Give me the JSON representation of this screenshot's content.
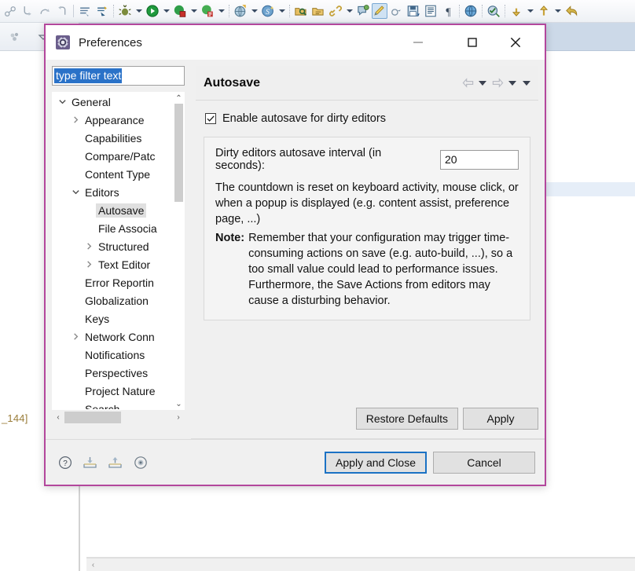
{
  "ide": {
    "toolbar_groups": [
      {
        "icons": [
          "debug-last-icon",
          "step-into-icon",
          "step-over-icon",
          "step-return-icon"
        ]
      },
      {
        "sep": "solid",
        "icons": [
          "run-menu-icon",
          "external-tools-icon"
        ]
      },
      {
        "sep": "dotted",
        "icons": [
          "debug-icon"
        ],
        "caret": true
      },
      {
        "icons": [
          "run-icon"
        ],
        "caret": true
      },
      {
        "icons": [
          "coverage-icon"
        ],
        "caret": true
      },
      {
        "icons": [
          "profile-icon"
        ],
        "caret": true
      },
      {
        "sep": "dotted",
        "icons": [
          "new-server-icon"
        ],
        "caret": true
      },
      {
        "icons": [
          "search-scm-icon"
        ],
        "caret": true
      },
      {
        "sep": "dotted",
        "icons": [
          "open-type-icon",
          "open-resource-icon",
          "link-icon"
        ],
        "caret": true
      },
      {
        "icons": [
          "annotation-icon",
          "pencil-highlight-icon",
          "quick-access-icon"
        ]
      },
      {
        "icons": [
          "save-all-icon",
          "block-selection-icon",
          "pilcrow-icon"
        ]
      },
      {
        "sep": "dotted",
        "icons": [
          "globe-icon"
        ]
      },
      {
        "sep": "dotted",
        "icons": [
          "validate-icon"
        ]
      },
      {
        "sep": "dotted",
        "icons": [
          "previous-annotation-icon"
        ],
        "caret": true
      },
      {
        "icons": [
          "next-annotation-icon"
        ],
        "caret": true
      },
      {
        "icons": [
          "back-nav-icon"
        ]
      }
    ],
    "strip2_icons": [
      "package-explorer-icon",
      "view-menu-icon"
    ],
    "left_pane_text": "_144]",
    "hscroll_left_arrow": "‹"
  },
  "dialog": {
    "title": "Preferences",
    "title_icon": "preferences-gear-icon",
    "window_buttons": {
      "minimize": "minimize-icon",
      "maximize": "maximize-icon",
      "close": "close-icon"
    },
    "filter": {
      "value": "type filter text",
      "placeholder": "type filter text"
    },
    "tree": [
      {
        "label": "General",
        "indent": 0,
        "twisty": "expanded",
        "selected": false
      },
      {
        "label": "Appearance",
        "indent": 1,
        "twisty": "collapsed",
        "selected": false
      },
      {
        "label": "Capabilities",
        "indent": 1,
        "twisty": "none",
        "selected": false
      },
      {
        "label": "Compare/Patc",
        "indent": 1,
        "twisty": "none",
        "selected": false
      },
      {
        "label": "Content Type",
        "indent": 1,
        "twisty": "none",
        "selected": false
      },
      {
        "label": "Editors",
        "indent": 1,
        "twisty": "expanded",
        "selected": false
      },
      {
        "label": "Autosave",
        "indent": 2,
        "twisty": "none",
        "selected": true
      },
      {
        "label": "File Associa",
        "indent": 2,
        "twisty": "none",
        "selected": false
      },
      {
        "label": "Structured",
        "indent": 2,
        "twisty": "collapsed",
        "selected": false
      },
      {
        "label": "Text Editor",
        "indent": 2,
        "twisty": "collapsed",
        "selected": false
      },
      {
        "label": "Error Reportin",
        "indent": 1,
        "twisty": "none",
        "selected": false
      },
      {
        "label": "Globalization",
        "indent": 1,
        "twisty": "none",
        "selected": false
      },
      {
        "label": "Keys",
        "indent": 1,
        "twisty": "none",
        "selected": false
      },
      {
        "label": "Network Conn",
        "indent": 1,
        "twisty": "collapsed",
        "selected": false
      },
      {
        "label": "Notifications",
        "indent": 1,
        "twisty": "none",
        "selected": false
      },
      {
        "label": "Perspectives",
        "indent": 1,
        "twisty": "none",
        "selected": false
      },
      {
        "label": "Project Nature",
        "indent": 1,
        "twisty": "none",
        "selected": false
      },
      {
        "label": "Search",
        "indent": 1,
        "twisty": "none",
        "selected": false
      }
    ],
    "tree_scroll": {
      "up_arrow": "⌃",
      "down_arrow": "⌄",
      "left_arrow": "‹",
      "right_arrow": "›"
    },
    "page": {
      "title": "Autosave",
      "nav": {
        "back": "back-arrow-icon",
        "back_menu": "chevron-down-icon",
        "forward": "forward-arrow-icon",
        "forward_menu": "chevron-down-icon",
        "overflow_menu": "chevron-down-icon"
      },
      "enable_checkbox": {
        "label": "Enable autosave for dirty editors",
        "checked": true
      },
      "interval": {
        "label": "Dirty editors autosave interval (in seconds):",
        "value": "20"
      },
      "description": "The countdown is reset on keyboard activity, mouse click, or when a popup is displayed (e.g. content assist, preference page, ...)",
      "note_label": "Note:",
      "note_text": "Remember that your configuration may trigger time-consuming actions on save (e.g. auto-build, ...), so a too small value could lead to performance issues. Furthermore, the Save Actions from editors may cause a disturbing behavior.",
      "restore_defaults_label": "Restore Defaults",
      "apply_label": "Apply"
    },
    "footer": {
      "icons": [
        {
          "name": "help-icon",
          "glyph": "?"
        },
        {
          "name": "import-preferences-icon"
        },
        {
          "name": "export-preferences-icon"
        },
        {
          "name": "filter-preferences-icon"
        }
      ],
      "apply_and_close_label": "Apply and Close",
      "cancel_label": "Cancel"
    }
  },
  "colors": {
    "dialog_border": "#b3479c",
    "selection_blue": "#2a72c8",
    "default_button_border": "#1b72c4",
    "tree_selection_grey": "#e0e0e0",
    "ide_band_blue": "#ccd9e8",
    "ide_highlight_row": "#e6eef8",
    "left_pane_text": "#9a7d3a"
  }
}
